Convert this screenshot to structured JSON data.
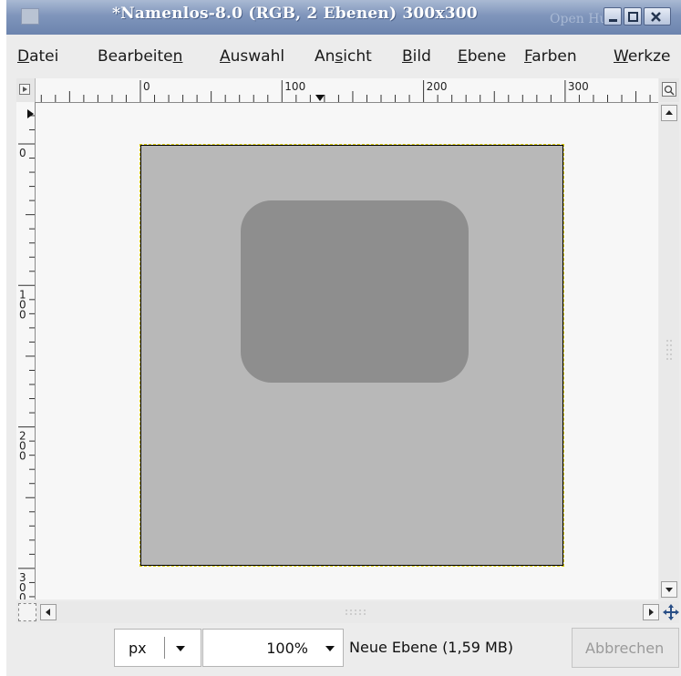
{
  "window": {
    "title": "*Namenlos-8.0 (RGB, 2 Ebenen) 300x300",
    "ghost_text": "Open Hum"
  },
  "menu": [
    {
      "label": "Datei",
      "mnemonic_index": 0
    },
    {
      "label": "Bearbeiten",
      "mnemonic_index": 9
    },
    {
      "label": "Auswahl",
      "mnemonic_index": 0
    },
    {
      "label": "Ansicht",
      "mnemonic_index": 2
    },
    {
      "label": "Bild",
      "mnemonic_index": 0
    },
    {
      "label": "Ebene",
      "mnemonic_index": 0
    },
    {
      "label": "Farben",
      "mnemonic_index": 0
    },
    {
      "label": "Werkze",
      "mnemonic_index": 0
    }
  ],
  "rulers": {
    "horizontal_labels": [
      "0",
      "100",
      "200",
      "300"
    ],
    "vertical_labels": [
      "0",
      "100",
      "200",
      "300"
    ]
  },
  "canvas": {
    "image_fill": "#b8b8b8",
    "layer_fill": "#8e8e8e",
    "selection_color": "#d8c800"
  },
  "statusbar": {
    "unit": "px",
    "zoom": "100%",
    "message": "Neue Ebene (1,59 MB)",
    "cancel_label": "Abbrechen"
  }
}
